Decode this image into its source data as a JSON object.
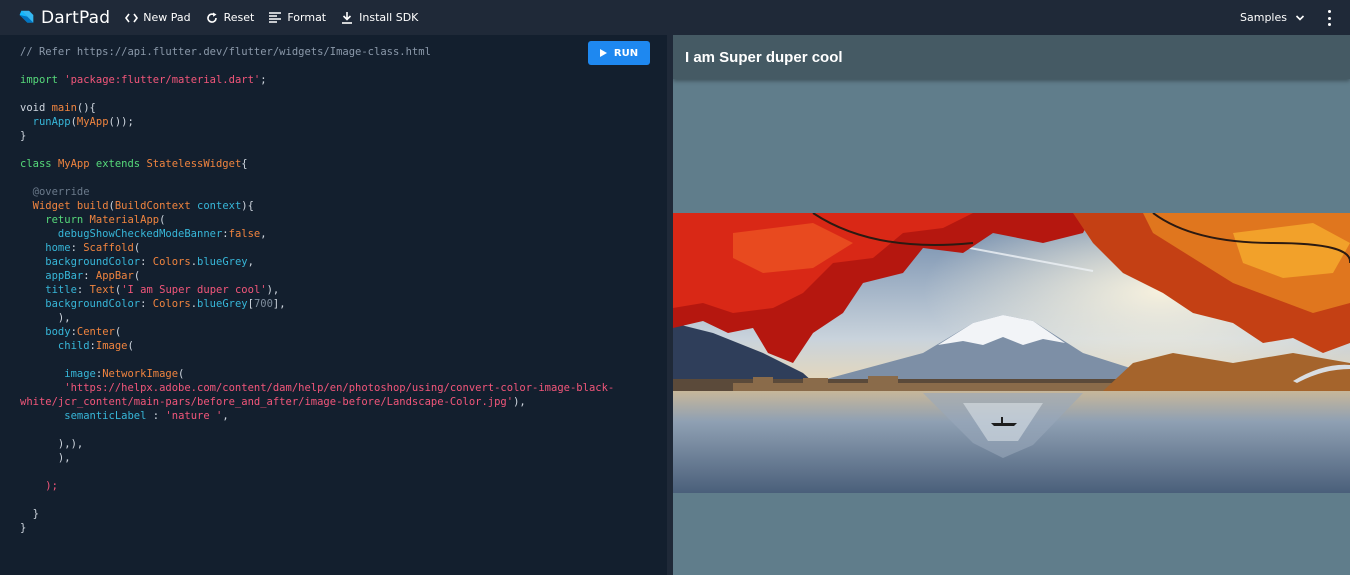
{
  "app": {
    "name": "DartPad"
  },
  "toolbar": {
    "new_pad": "New Pad",
    "reset": "Reset",
    "format": "Format",
    "install_sdk": "Install SDK",
    "samples": "Samples"
  },
  "editor": {
    "run_label": "RUN",
    "lines": [
      [
        {
          "t": "// Refer https://api.flutter.dev/flutter/widgets/Image-class.html",
          "c": "cm"
        }
      ],
      [],
      [
        {
          "t": "import ",
          "c": "kw"
        },
        {
          "t": "'package:flutter/material.dart'",
          "c": "str"
        },
        {
          "t": ";",
          "c": "pl"
        }
      ],
      [],
      [
        {
          "t": "void ",
          "c": "pl"
        },
        {
          "t": "main",
          "c": "fn"
        },
        {
          "t": "(){",
          "c": "pl"
        }
      ],
      [
        {
          "t": "  runApp",
          "c": "prop"
        },
        {
          "t": "(",
          "c": "pl"
        },
        {
          "t": "MyApp",
          "c": "cls"
        },
        {
          "t": "());",
          "c": "pl"
        }
      ],
      [
        {
          "t": "}",
          "c": "pl"
        }
      ],
      [],
      [
        {
          "t": "class ",
          "c": "kw"
        },
        {
          "t": "MyApp ",
          "c": "cls"
        },
        {
          "t": "extends ",
          "c": "kw"
        },
        {
          "t": "StatelessWidget",
          "c": "cls"
        },
        {
          "t": "{",
          "c": "pl"
        }
      ],
      [],
      [
        {
          "t": "  @override",
          "c": "ann"
        }
      ],
      [
        {
          "t": "  Widget ",
          "c": "cls"
        },
        {
          "t": "build",
          "c": "fn"
        },
        {
          "t": "(",
          "c": "pl"
        },
        {
          "t": "BuildContext ",
          "c": "cls"
        },
        {
          "t": "context",
          "c": "prop"
        },
        {
          "t": "){",
          "c": "pl"
        }
      ],
      [
        {
          "t": "    return ",
          "c": "kw"
        },
        {
          "t": "MaterialApp",
          "c": "cls"
        },
        {
          "t": "(",
          "c": "pl"
        }
      ],
      [
        {
          "t": "      debugShowCheckedModeBanner",
          "c": "prop"
        },
        {
          "t": ":",
          "c": "pl"
        },
        {
          "t": "false",
          "c": "fn"
        },
        {
          "t": ",",
          "c": "pl"
        }
      ],
      [
        {
          "t": "    home",
          "c": "prop"
        },
        {
          "t": ": ",
          "c": "pl"
        },
        {
          "t": "Scaffold",
          "c": "cls"
        },
        {
          "t": "(",
          "c": "pl"
        }
      ],
      [
        {
          "t": "    backgroundColor",
          "c": "prop"
        },
        {
          "t": ": ",
          "c": "pl"
        },
        {
          "t": "Colors",
          "c": "cls"
        },
        {
          "t": ".",
          "c": "pl"
        },
        {
          "t": "blueGrey",
          "c": "prop"
        },
        {
          "t": ",",
          "c": "pl"
        }
      ],
      [
        {
          "t": "    appBar",
          "c": "prop"
        },
        {
          "t": ": ",
          "c": "pl"
        },
        {
          "t": "AppBar",
          "c": "cls"
        },
        {
          "t": "(",
          "c": "pl"
        }
      ],
      [
        {
          "t": "    title",
          "c": "prop"
        },
        {
          "t": ": ",
          "c": "pl"
        },
        {
          "t": "Text",
          "c": "cls"
        },
        {
          "t": "(",
          "c": "pl"
        },
        {
          "t": "'I am Super duper cool'",
          "c": "str"
        },
        {
          "t": "),",
          "c": "pl"
        }
      ],
      [
        {
          "t": "    backgroundColor",
          "c": "prop"
        },
        {
          "t": ": ",
          "c": "pl"
        },
        {
          "t": "Colors",
          "c": "cls"
        },
        {
          "t": ".",
          "c": "pl"
        },
        {
          "t": "blueGrey",
          "c": "prop"
        },
        {
          "t": "[",
          "c": "pl"
        },
        {
          "t": "700",
          "c": "num"
        },
        {
          "t": "],",
          "c": "pl"
        }
      ],
      [
        {
          "t": "      ),",
          "c": "pl"
        }
      ],
      [
        {
          "t": "    body",
          "c": "prop"
        },
        {
          "t": ":",
          "c": "pl"
        },
        {
          "t": "Center",
          "c": "cls"
        },
        {
          "t": "(",
          "c": "pl"
        }
      ],
      [
        {
          "t": "      child",
          "c": "prop"
        },
        {
          "t": ":",
          "c": "pl"
        },
        {
          "t": "Image",
          "c": "cls"
        },
        {
          "t": "(",
          "c": "pl"
        }
      ],
      [],
      [
        {
          "t": "       image",
          "c": "prop"
        },
        {
          "t": ":",
          "c": "pl"
        },
        {
          "t": "NetworkImage",
          "c": "cls"
        },
        {
          "t": "(",
          "c": "pl"
        }
      ],
      [
        {
          "t": "       'https://helpx.adobe.com/content/dam/help/en/photoshop/using/convert-color-image-black-",
          "c": "str"
        }
      ],
      [
        {
          "t": "white/jcr_content/main-pars/before_and_after/image-before/Landscape-Color.jpg'",
          "c": "str"
        },
        {
          "t": "),",
          "c": "pl"
        }
      ],
      [
        {
          "t": "       semanticLabel ",
          "c": "prop"
        },
        {
          "t": ": ",
          "c": "pl"
        },
        {
          "t": "'nature '",
          "c": "str"
        },
        {
          "t": ",",
          "c": "pl"
        }
      ],
      [],
      [
        {
          "t": "      ),),",
          "c": "pl"
        }
      ],
      [
        {
          "t": "      ),",
          "c": "pl"
        }
      ],
      [],
      [
        {
          "t": "    );",
          "c": "str"
        }
      ],
      [],
      [
        {
          "t": "  }",
          "c": "pl"
        }
      ],
      [
        {
          "t": "}",
          "c": "pl"
        }
      ]
    ]
  },
  "preview": {
    "appbar_title": "I am Super duper cool",
    "appbar_color": "#455a64",
    "background_color": "#607d8b"
  },
  "colors": {
    "accent": "#1e88f0",
    "toolbar_bg": "#1f2938",
    "editor_bg": "#131f2e"
  }
}
